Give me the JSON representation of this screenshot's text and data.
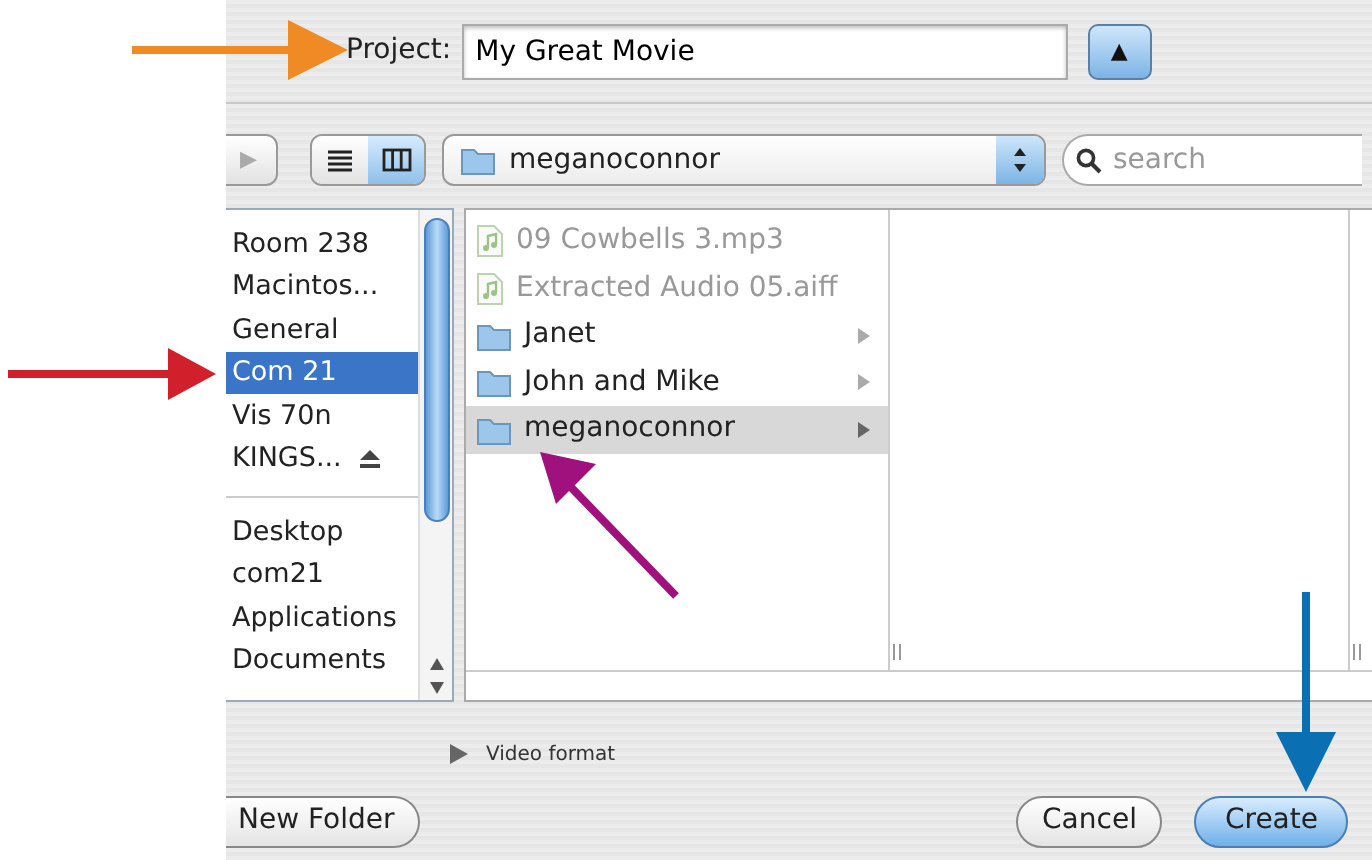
{
  "project": {
    "label": "Project:",
    "value": "My Great Movie",
    "expand_button": "▲"
  },
  "toolbar": {
    "forward_button": "▶",
    "view_modes": [
      {
        "kind": "list",
        "selected": false
      },
      {
        "kind": "columns",
        "selected": true
      }
    ],
    "location": "meganoconnor",
    "search": {
      "placeholder": "search"
    }
  },
  "sidebar": {
    "groups": [
      [
        {
          "label": "Room 238",
          "selected": false,
          "eject": false
        },
        {
          "label": "Macintos...",
          "selected": false,
          "eject": false
        },
        {
          "label": "General",
          "selected": false,
          "eject": false
        },
        {
          "label": "Com 21",
          "selected": true,
          "eject": false
        },
        {
          "label": "Vis 70n",
          "selected": false,
          "eject": false
        },
        {
          "label": "KINGS...",
          "selected": false,
          "eject": true
        }
      ],
      [
        {
          "label": "Desktop",
          "selected": false,
          "eject": false
        },
        {
          "label": "com21",
          "selected": false,
          "eject": false
        },
        {
          "label": "Applications",
          "selected": false,
          "eject": false
        },
        {
          "label": "Documents",
          "selected": false,
          "eject": false
        }
      ]
    ]
  },
  "files": [
    {
      "name": "09 Cowbells 3.mp3",
      "kind": "audio",
      "disabled": true,
      "selected": false
    },
    {
      "name": "Extracted Audio 05.aiff",
      "kind": "audio",
      "disabled": true,
      "selected": false
    },
    {
      "name": "Janet",
      "kind": "folder",
      "disabled": false,
      "selected": false
    },
    {
      "name": "John and Mike",
      "kind": "folder",
      "disabled": false,
      "selected": false
    },
    {
      "name": "meganoconnor",
      "kind": "folder",
      "disabled": false,
      "selected": true
    }
  ],
  "disclosure": {
    "label": "Video format",
    "expanded": false
  },
  "buttons": [
    {
      "label": "New Folder",
      "kind": "plain"
    },
    {
      "label": "Cancel",
      "kind": "plain"
    },
    {
      "label": "Create",
      "kind": "default"
    }
  ],
  "annotations": [
    {
      "kind": "right",
      "color": "#f08a24"
    },
    {
      "kind": "right",
      "color": "#d0202c"
    },
    {
      "kind": "up-left",
      "color": "#a0117d"
    },
    {
      "kind": "down",
      "color": "#0b6fb3"
    }
  ]
}
